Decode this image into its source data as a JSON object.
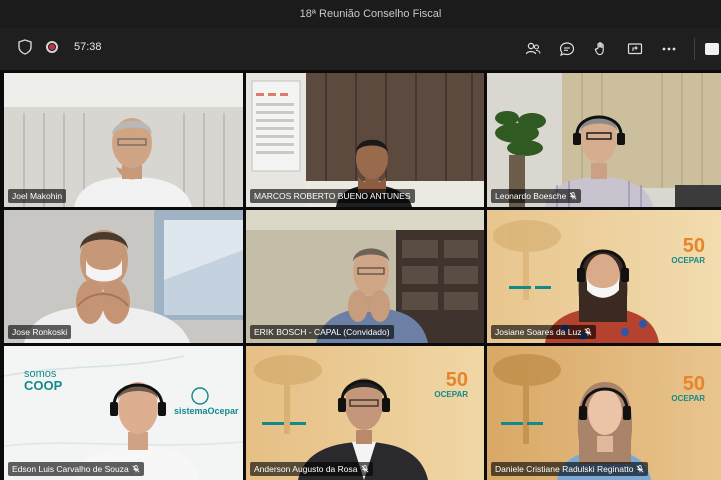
{
  "window": {
    "title": "18ª Reunião Conselho Fiscal"
  },
  "toolbar": {
    "timer": "57:38",
    "icons": [
      "shield-icon",
      "record-icon",
      "participants-icon",
      "chat-icon",
      "reactions-icon",
      "share-icon",
      "more-icon",
      "camera-icon"
    ]
  },
  "participants": [
    {
      "name": "Joel Makohin",
      "muted": false
    },
    {
      "name": "MARCOS ROBERTO BUENO ANTUNES",
      "muted": false
    },
    {
      "name": "Leonardo Boesche",
      "muted": true
    },
    {
      "name": "Jose Ronkoski",
      "muted": false
    },
    {
      "name": "ERIK BOSCH - CAPAL (Convidado)",
      "muted": false
    },
    {
      "name": "Josiane Soares da Luz",
      "muted": true
    },
    {
      "name": "Edson Luis Carvalho de Souza",
      "muted": true
    },
    {
      "name": "Anderson Augusto da Rosa",
      "muted": true
    },
    {
      "name": "Daniele Cristiane Radulski Reginatto",
      "muted": true
    }
  ],
  "branding": {
    "somos_line1": "somos",
    "somos_line2": "COOP",
    "sistema": "sistemaOcepar",
    "ocepar_50": "50",
    "ocepar_word": "OCEPAR"
  },
  "colors": {
    "ocepar_orange": "#e8842a",
    "ocepar_teal": "#138a8a",
    "coop_green": "#6bb33f",
    "background": "#0b0b0b"
  }
}
